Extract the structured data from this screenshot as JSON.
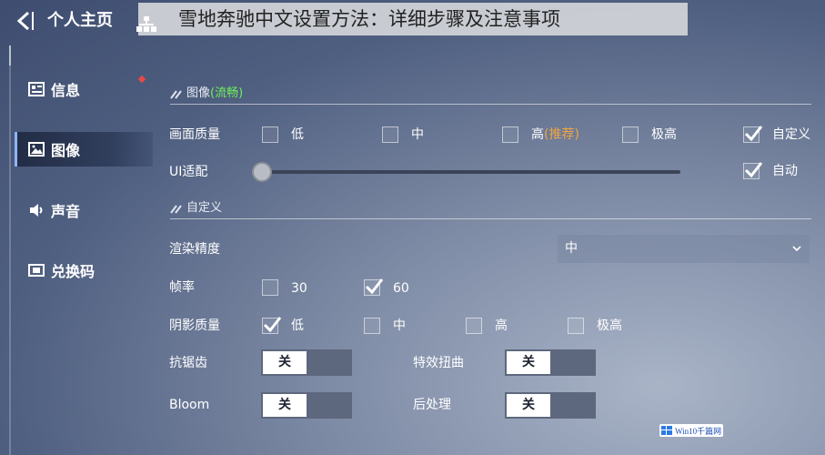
{
  "overlay": {
    "title": "雪地奔驰中文设置方法：详细步骤及注意事项"
  },
  "header": {
    "title": "个人主页"
  },
  "sidebar": {
    "items": [
      {
        "label": "信息",
        "icon": "info-card-icon",
        "active": false,
        "has_notification": true
      },
      {
        "label": "图像",
        "icon": "image-icon",
        "active": true,
        "has_notification": false
      },
      {
        "label": "声音",
        "icon": "speaker-icon",
        "active": false,
        "has_notification": false
      },
      {
        "label": "兑换码",
        "icon": "redeem-code-icon",
        "active": false,
        "has_notification": false
      }
    ]
  },
  "image_section": {
    "title": "图像",
    "title_status": "(流畅)",
    "quality": {
      "label": "画面质量",
      "options": [
        {
          "label": "低",
          "checked": false
        },
        {
          "label": "中",
          "checked": false
        },
        {
          "label": "高",
          "tag": "(推荐)",
          "checked": false
        },
        {
          "label": "极高",
          "checked": false
        },
        {
          "label": "自定义",
          "checked": true
        }
      ]
    },
    "ui_adapt": {
      "label": "UI适配",
      "slider_value": 0.0,
      "auto_label": "自动",
      "auto_checked": true
    }
  },
  "custom_section": {
    "title": "自定义",
    "render_precision": {
      "label": "渲染精度",
      "value": "中"
    },
    "frame_rate": {
      "label": "帧率",
      "options": [
        {
          "label": "30",
          "checked": false
        },
        {
          "label": "60",
          "checked": true
        }
      ]
    },
    "shadow_quality": {
      "label": "阴影质量",
      "options": [
        {
          "label": "低",
          "checked": true
        },
        {
          "label": "中",
          "checked": false
        },
        {
          "label": "高",
          "checked": false
        },
        {
          "label": "极高",
          "checked": false
        }
      ]
    },
    "anti_aliasing": {
      "label": "抗锯齿",
      "state": "关"
    },
    "effects_distortion": {
      "label": "特效扭曲",
      "state": "关"
    },
    "bloom": {
      "label": "Bloom",
      "state": "关"
    },
    "post_processing": {
      "label": "后处理",
      "state": "关"
    }
  },
  "watermark": {
    "text": "Win10千篇网"
  },
  "colors": {
    "accent_green": "#6ff05a",
    "recommend_orange": "#f2a541",
    "notification_red": "#e84a4a"
  }
}
